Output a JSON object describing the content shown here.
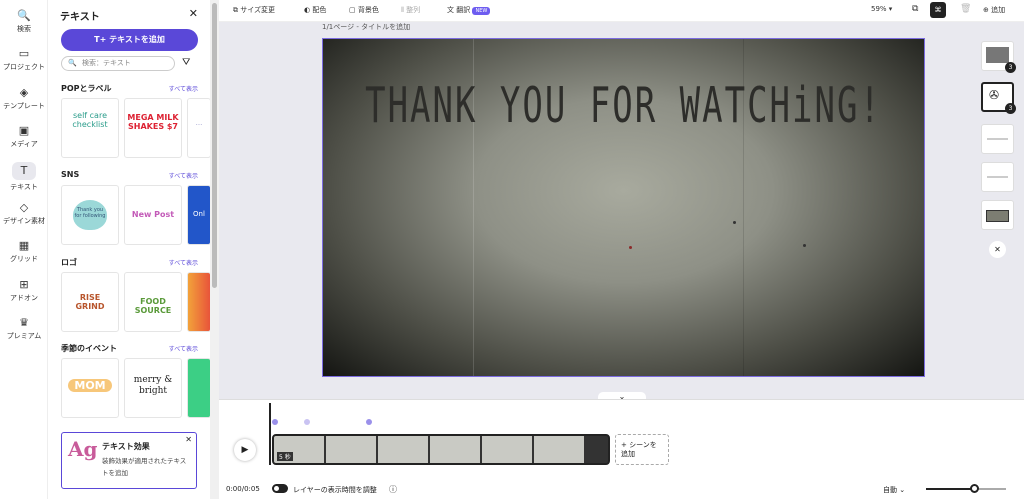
{
  "rail": [
    {
      "label": "検索",
      "icon": "search-icon",
      "glyph": "🔍"
    },
    {
      "label": "プロジェクト",
      "icon": "folder-icon",
      "glyph": "▭"
    },
    {
      "label": "テンプレート",
      "icon": "template-icon",
      "glyph": "◈"
    },
    {
      "label": "メディア",
      "icon": "media-icon",
      "glyph": "▣"
    },
    {
      "label": "テキスト",
      "icon": "text-icon",
      "glyph": "T"
    },
    {
      "label": "デザイン素材",
      "icon": "shapes-icon",
      "glyph": "◇"
    },
    {
      "label": "グリッド",
      "icon": "grid-icon",
      "glyph": "▦"
    },
    {
      "label": "アドオン",
      "icon": "addon-icon",
      "glyph": "⊞"
    },
    {
      "label": "プレミアム",
      "icon": "crown-icon",
      "glyph": "♛"
    }
  ],
  "panel": {
    "title": "テキスト",
    "add_label": "テキストを追加",
    "search_placeholder": "検索：テキスト",
    "see_all": "すべて表示",
    "sections": [
      {
        "title": "POPとラベル",
        "thumbs": [
          "self care checklist",
          "MEGA MILK SHAKES $7",
          "..."
        ]
      },
      {
        "title": "SNS",
        "thumbs": [
          "Thank you for following",
          "New Post",
          "Onl"
        ]
      },
      {
        "title": "ロゴ",
        "thumbs": [
          "RISE GRIND",
          "FOOD SOURCE",
          ""
        ]
      },
      {
        "title": "季節のイベント",
        "thumbs": [
          "MOM",
          "merry & bright",
          ""
        ]
      }
    ],
    "effect": {
      "title": "テキスト効果",
      "desc": "装飾効果が適用されたテキストを追加",
      "logo": "Ag"
    }
  },
  "toolbar": {
    "resize": "サイズ変更",
    "color": "配色",
    "bg_color": "背景色",
    "align": "整列",
    "translate": "翻訳",
    "new_badge": "NEW",
    "zoom": "59%",
    "add": "追加"
  },
  "page_label": "1/1ページ - タイトルを追加",
  "slide_text": "THANK YOU FOR WATCHiNG!",
  "timeline": {
    "duration": "0:00/0:05",
    "clip_len": "5 秒",
    "layer_toggle": "レイヤーの表示時間を調整",
    "add_scene": "+ シーンを追加",
    "mode": "自動"
  },
  "scene_badges": [
    "3",
    "3"
  ]
}
